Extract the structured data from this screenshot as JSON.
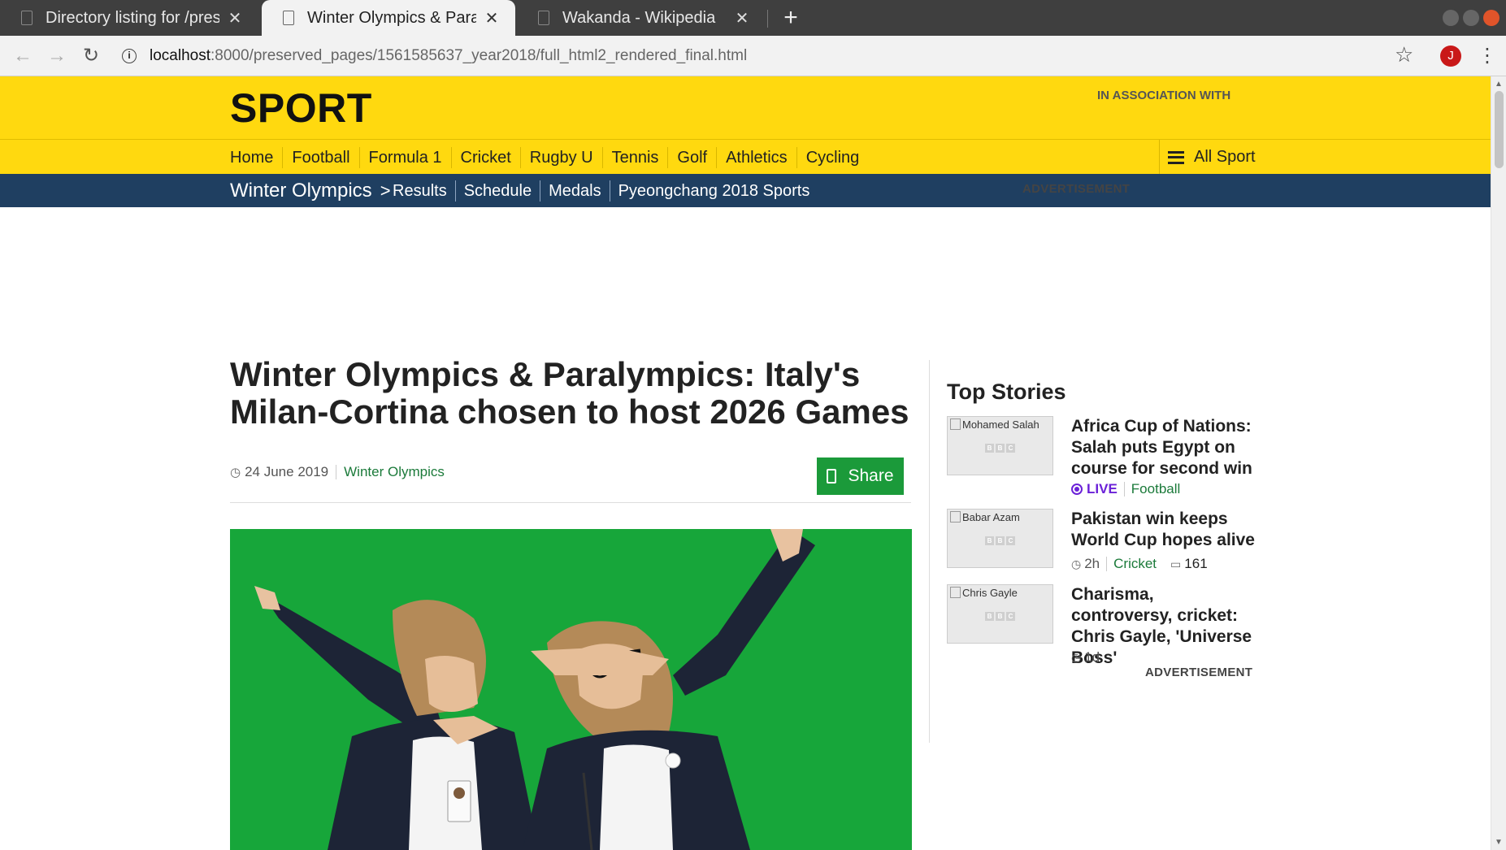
{
  "browser": {
    "tabs": [
      {
        "title": "Directory listing for /preserved_pages/"
      },
      {
        "title": "Winter Olympics & Paralympics: Italy's Milan-Cortina chosen"
      },
      {
        "title": "Wakanda - Wikipedia"
      }
    ],
    "close_glyph": "✕",
    "new_tab_glyph": "+",
    "url_host": "localhost",
    "url_path": ":8000/preserved_pages/1561585637_year2018/full_html2_rendered_final.html",
    "profile_initial": "J"
  },
  "header": {
    "title": "SPORT",
    "association": "IN ASSOCIATION WITH"
  },
  "nav": {
    "items": [
      "Home",
      "Football",
      "Formula 1",
      "Cricket",
      "Rugby U",
      "Tennis",
      "Golf",
      "Athletics",
      "Cycling"
    ],
    "all_sport": "All Sport"
  },
  "subnav": {
    "section": "Winter Olympics",
    "chevron": ">",
    "items": [
      "Results",
      "Schedule",
      "Medals",
      "Pyeongchang 2018 Sports"
    ]
  },
  "ads": {
    "label": "ADVERTISEMENT"
  },
  "article": {
    "headline": "Winter Olympics & Paralympics: Italy's Milan-Cortina chosen to host 2026 Games",
    "date": "24 June 2019",
    "category": "Winter Olympics",
    "share_label": "Share"
  },
  "top_stories": {
    "heading": "Top Stories",
    "items": [
      {
        "image_alt": "Mohamed Salah",
        "title": "Africa Cup of Nations: Salah puts Egypt on course for second win",
        "live": "LIVE",
        "category": "Football"
      },
      {
        "image_alt": "Babar Azam",
        "title": "Pakistan win keeps World Cup hopes alive",
        "time": "2h",
        "category": "Cricket",
        "comments": "161"
      },
      {
        "image_alt": "Chris Gayle",
        "title": "Charisma, controversy, cricket: Chris Gayle, 'Universe Boss'",
        "time": "1d"
      }
    ]
  },
  "colors": {
    "sport_yellow": "#ffd90f",
    "subnav_blue": "#1f3f61",
    "share_green": "#1b9a3a",
    "hero_green": "#17a63a",
    "live_purple": "#6b21d8"
  }
}
